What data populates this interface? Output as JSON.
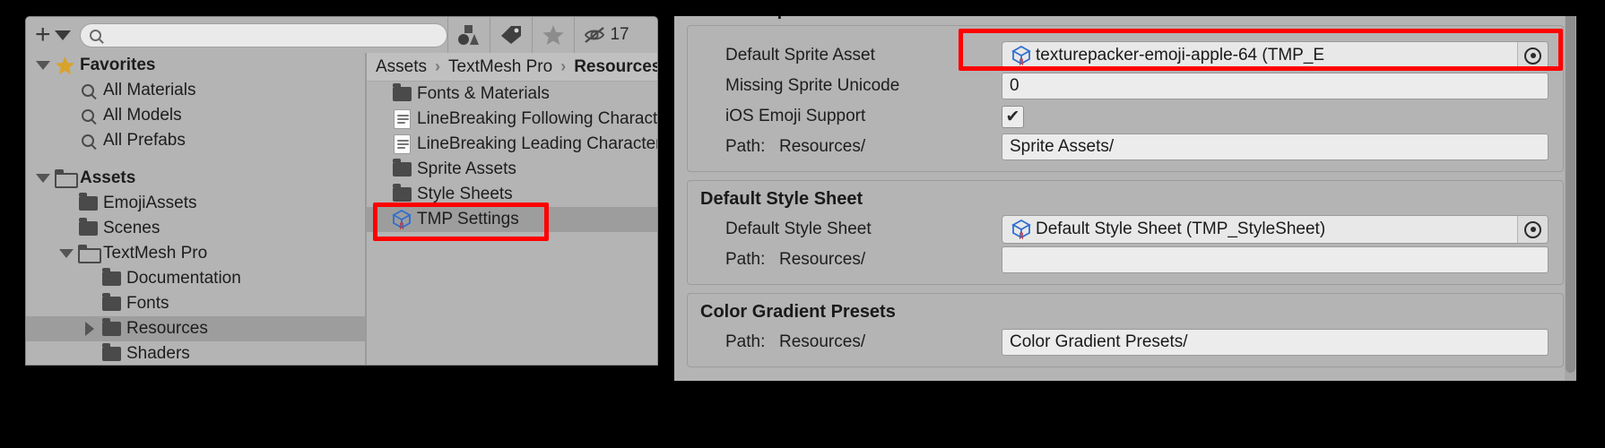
{
  "project_window": {
    "toolbar": {
      "add_label": "+",
      "add_dropdown_icon": "caret-down-icon",
      "search_placeholder": "",
      "search_value": "",
      "filter_buttons": [
        {
          "name": "shapes-filter",
          "icon": "shapes-icon"
        },
        {
          "name": "label-filter",
          "icon": "tag-icon"
        },
        {
          "name": "favorite-filter",
          "icon": "star-icon"
        },
        {
          "name": "hidden-count",
          "icon": "eye-slash-icon",
          "count": "17"
        }
      ]
    },
    "left_tree": [
      {
        "label": "Favorites",
        "icon": "star-icon",
        "twisty": "down",
        "indent": 0,
        "bold": true,
        "selected": false
      },
      {
        "label": "All Materials",
        "icon": "search-icon",
        "twisty": "none",
        "indent": 1,
        "bold": false,
        "selected": false
      },
      {
        "label": "All Models",
        "icon": "search-icon",
        "twisty": "none",
        "indent": 1,
        "bold": false,
        "selected": false
      },
      {
        "label": "All Prefabs",
        "icon": "search-icon",
        "twisty": "none",
        "indent": 1,
        "bold": false,
        "selected": false
      },
      {
        "label": "",
        "icon": "none",
        "twisty": "none",
        "indent": 0,
        "bold": false,
        "selected": false
      },
      {
        "label": "Assets",
        "icon": "folder-open-icon",
        "twisty": "down",
        "indent": 0,
        "bold": true,
        "selected": false
      },
      {
        "label": "EmojiAssets",
        "icon": "folder-icon",
        "twisty": "none",
        "indent": 1,
        "bold": false,
        "selected": false
      },
      {
        "label": "Scenes",
        "icon": "folder-icon",
        "twisty": "none",
        "indent": 1,
        "bold": false,
        "selected": false
      },
      {
        "label": "TextMesh Pro",
        "icon": "folder-open-icon",
        "twisty": "down",
        "indent": 1,
        "bold": false,
        "selected": false
      },
      {
        "label": "Documentation",
        "icon": "folder-icon",
        "twisty": "none",
        "indent": 2,
        "bold": false,
        "selected": false
      },
      {
        "label": "Fonts",
        "icon": "folder-icon",
        "twisty": "none",
        "indent": 2,
        "bold": false,
        "selected": false
      },
      {
        "label": "Resources",
        "icon": "folder-icon",
        "twisty": "right",
        "indent": 2,
        "bold": false,
        "selected": true
      },
      {
        "label": "Shaders",
        "icon": "folder-icon",
        "twisty": "none",
        "indent": 2,
        "bold": false,
        "selected": false
      }
    ],
    "breadcrumb": [
      {
        "label": "Assets",
        "current": false
      },
      {
        "label": "TextMesh Pro",
        "current": false
      },
      {
        "label": "Resources",
        "current": true
      }
    ],
    "breadcrumb_separator": "›",
    "file_list": [
      {
        "label": "Fonts & Materials",
        "icon": "folder-icon",
        "selected": false
      },
      {
        "label": "LineBreaking Following Characters",
        "icon": "text-asset-icon",
        "selected": false
      },
      {
        "label": "LineBreaking Leading Characters",
        "icon": "text-asset-icon",
        "selected": false
      },
      {
        "label": "Sprite Assets",
        "icon": "folder-icon",
        "selected": false
      },
      {
        "label": "Style Sheets",
        "icon": "folder-icon",
        "selected": false
      },
      {
        "label": "TMP Settings",
        "icon": "tmp-settings-icon",
        "selected": true
      }
    ]
  },
  "inspector": {
    "clipped_section_title": "Default Sprite Asset",
    "sections": [
      {
        "title": "Default Sprite Asset",
        "rows": [
          {
            "type": "object",
            "label": "Default Sprite Asset",
            "value": "texturepacker-emoji-apple-64 (TMP_E",
            "icon": "tmp-asset-icon",
            "picker": "target-icon",
            "highlighted": true
          },
          {
            "type": "text",
            "label": "Missing Sprite Unicode",
            "value": "0"
          },
          {
            "type": "checkbox",
            "label": "iOS Emoji Support",
            "checked": true,
            "check_glyph": "✔"
          },
          {
            "type": "path",
            "label": "Path:",
            "sublabel": "Resources/",
            "value": "Sprite Assets/"
          }
        ]
      },
      {
        "title": "Default Style Sheet",
        "rows": [
          {
            "type": "object",
            "label": "Default Style Sheet",
            "value": "Default Style Sheet (TMP_StyleSheet)",
            "icon": "tmp-asset-icon",
            "picker": "target-icon",
            "highlighted": false
          },
          {
            "type": "path",
            "label": "Path:",
            "sublabel": "Resources/",
            "value": ""
          }
        ]
      },
      {
        "title": "Color Gradient Presets",
        "rows": [
          {
            "type": "path",
            "label": "Path:",
            "sublabel": "Resources/",
            "value": "Color Gradient Presets/"
          }
        ]
      }
    ]
  },
  "colors": {
    "panel_bg": "#b4b4b4",
    "selected_row": "#9d9d9d",
    "field_bg": "#ececec",
    "highlight_red": "#ff0000",
    "star_gold": "#d8a32b",
    "cube_blue": "#2f6fd0",
    "cube_red": "#cc2222"
  }
}
